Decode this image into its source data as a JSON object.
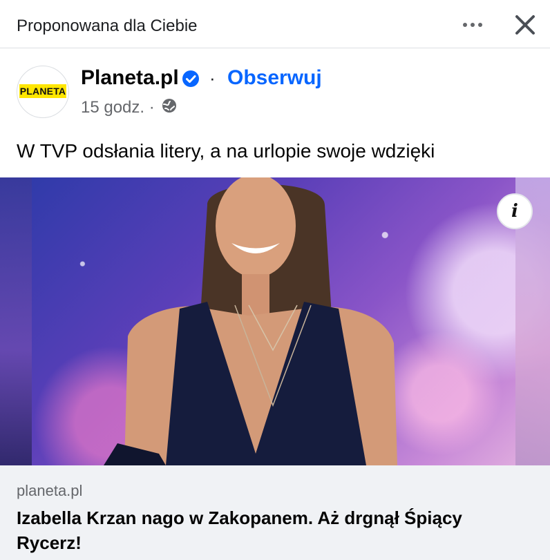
{
  "header": {
    "title": "Proponowana dla Ciebie",
    "more_icon": "more-dots-icon",
    "close_icon": "close-icon"
  },
  "post": {
    "page_name": "Planeta.pl",
    "logo_text": "PLANETA",
    "follow_label": "Obserwuj",
    "separator": "·",
    "time": "15 godz. ·",
    "audience_icon": "globe-icon",
    "verified_icon": "verified-badge-icon",
    "text": "W TVP odsłania litery, a na urlopie swoje wdzięki",
    "info_label": "i"
  },
  "link_preview": {
    "domain": "planeta.pl",
    "headline": "Izabella Krzan nago w Zakopanem. Aż drgnął Śpiący Rycerz!"
  },
  "colors": {
    "accent": "#0866ff",
    "logo_yellow": "#ffe600",
    "secondary_text": "#65676b",
    "preview_bg": "#f0f2f5"
  }
}
